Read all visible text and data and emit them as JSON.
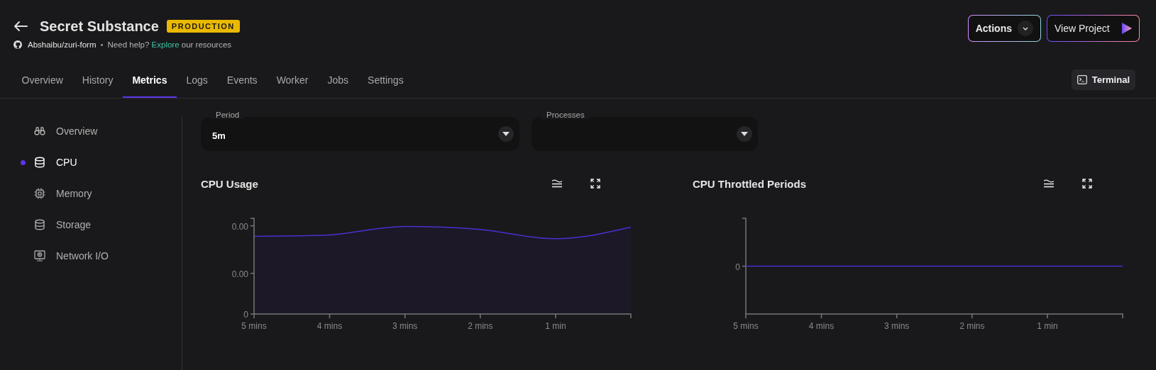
{
  "header": {
    "title": "Secret Substance",
    "badge": "PRODUCTION",
    "repo": "Abshaibu/zuri-form",
    "separator": "•",
    "help": {
      "before": "Need help? ",
      "link": "Explore",
      "after": " our resources"
    }
  },
  "actions": [
    {
      "label": "Actions",
      "kind": "menu"
    },
    {
      "label": "View Project",
      "kind": "launch"
    }
  ],
  "tabs": [
    {
      "label": "Overview",
      "selected": false
    },
    {
      "label": "History",
      "selected": false
    },
    {
      "label": "Metrics",
      "selected": true
    },
    {
      "label": "Logs",
      "selected": false
    },
    {
      "label": "Events",
      "selected": false
    },
    {
      "label": "Worker",
      "selected": false
    },
    {
      "label": "Jobs",
      "selected": false
    },
    {
      "label": "Settings",
      "selected": false
    }
  ],
  "terminal_button": "Terminal",
  "sidebar": {
    "items": [
      {
        "label": "Overview",
        "selected": false
      },
      {
        "label": "CPU",
        "selected": true
      },
      {
        "label": "Memory",
        "selected": false
      },
      {
        "label": "Storage",
        "selected": false
      },
      {
        "label": "Network I/O",
        "selected": false
      }
    ]
  },
  "filters": [
    {
      "label": "Period",
      "value": "5m"
    },
    {
      "label": "Processes"
    }
  ],
  "charts": [
    {
      "title": "CPU Usage",
      "y_tick_labels": [
        "0.00",
        "0.00",
        "0"
      ],
      "x_tick_labels": [
        "5 mins",
        "4 mins",
        "3 mins",
        "2 mins",
        "1 min"
      ]
    },
    {
      "title": "CPU Throttled Periods",
      "y_tick_labels": [
        "0"
      ],
      "x_tick_labels": [
        "5 mins",
        "4 mins",
        "3 mins",
        "2 mins",
        "1 min"
      ]
    }
  ]
}
